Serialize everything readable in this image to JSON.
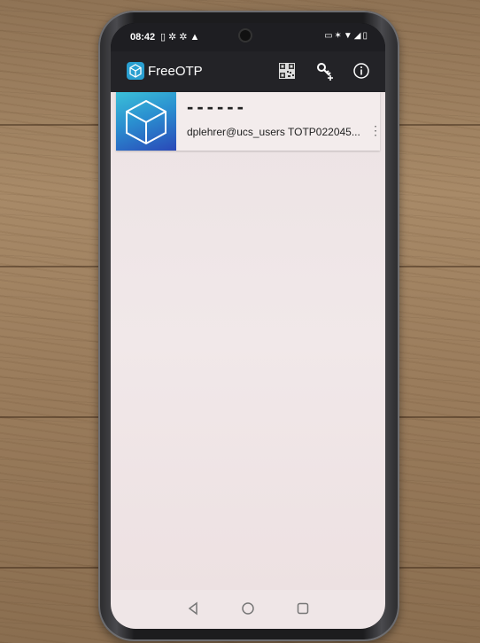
{
  "statusbar": {
    "time": "08:42",
    "left_icons": "▯✲✲▲",
    "right_icons": "▭✶▼◢▯"
  },
  "appbar": {
    "title": "FreeOTP",
    "icons": [
      "app-logo-icon",
      "qr-code-icon",
      "add-key-icon",
      "info-icon"
    ]
  },
  "token": {
    "code": "------",
    "label": "dplehrer@ucs_users TOTP022045...",
    "menu_glyph": "⋮"
  },
  "navbar": {
    "icons": [
      "back-icon",
      "home-icon",
      "recents-icon"
    ]
  },
  "colors": {
    "appbar": "#232327",
    "token_gradient_top": "#3bc0d8",
    "token_gradient_bottom": "#2a48b8",
    "content_bg": "#efe6e7"
  }
}
